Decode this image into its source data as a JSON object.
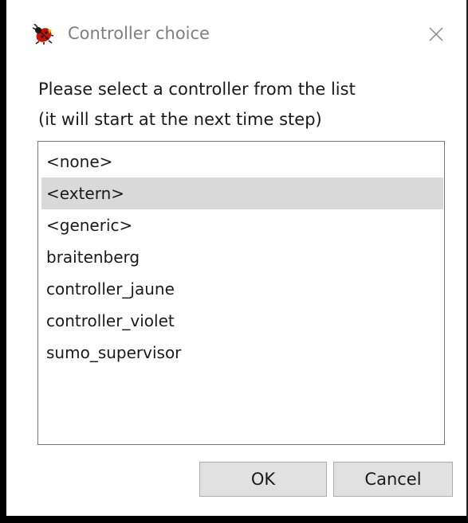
{
  "window": {
    "title": "Controller choice",
    "icon": "ladybug-icon",
    "close_icon": "close-icon"
  },
  "prompt": {
    "line1": "Please select a controller from the list",
    "line2": "(it will start at the next time step)"
  },
  "controllers": {
    "items": [
      {
        "label": "<none>"
      },
      {
        "label": "<extern>"
      },
      {
        "label": "<generic>"
      },
      {
        "label": "braitenberg"
      },
      {
        "label": "controller_jaune"
      },
      {
        "label": "controller_violet"
      },
      {
        "label": "sumo_supervisor"
      }
    ],
    "selected_index": 1
  },
  "buttons": {
    "ok_label": "OK",
    "cancel_label": "Cancel"
  },
  "colors": {
    "selection": "#d9d9d9",
    "button_face": "#e1e1e1",
    "title_text": "#7f7f7f"
  }
}
